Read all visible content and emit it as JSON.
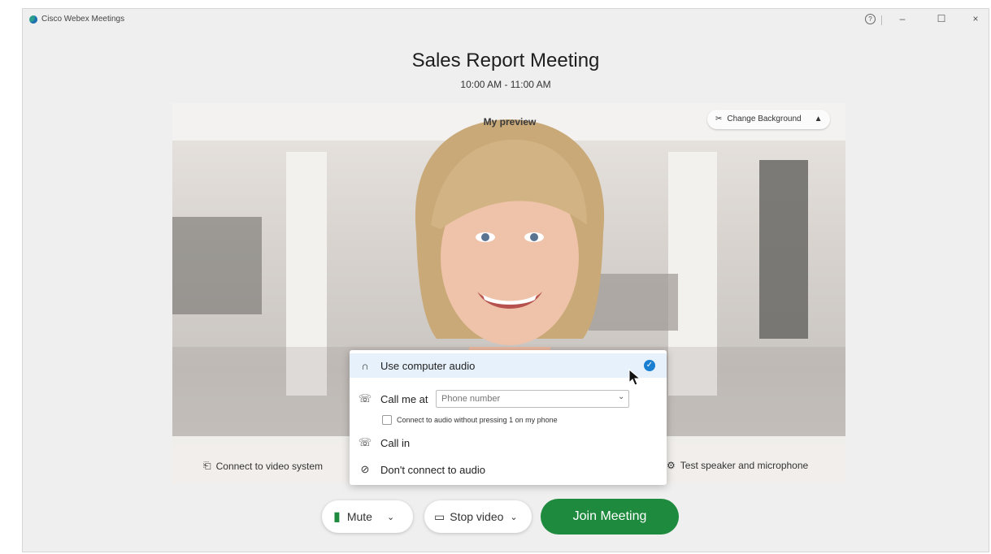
{
  "window": {
    "app_title": "Cisco Webex Meetings",
    "help_glyph": "?",
    "minimize_glyph": "–",
    "maximize_glyph": "☐",
    "close_glyph": "×"
  },
  "meeting": {
    "title": "Sales Report Meeting",
    "time": "10:00 AM - 11:00 AM"
  },
  "preview": {
    "label": "My preview",
    "change_background_label": "Change Background",
    "connect_video_label": "Connect to video system",
    "test_speaker_label": "Test speaker and microphone"
  },
  "audio_menu": {
    "items": [
      {
        "label": "Use computer audio",
        "icon": "headset-icon",
        "selected": true
      },
      {
        "label": "Call me at",
        "icon": "phone-callback-icon"
      },
      {
        "label": "Call in",
        "icon": "phone-call-icon"
      },
      {
        "label": "Don't connect to audio",
        "icon": "no-audio-icon"
      }
    ],
    "phone_placeholder": "Phone number",
    "checkbox_label": "Connect to audio without pressing 1 on my phone"
  },
  "controls": {
    "mute_label": "Mute",
    "stop_video_label": "Stop video",
    "join_label": "Join Meeting"
  },
  "colors": {
    "accent_green": "#1e8a3e",
    "selection_blue": "#1a7fd1"
  }
}
